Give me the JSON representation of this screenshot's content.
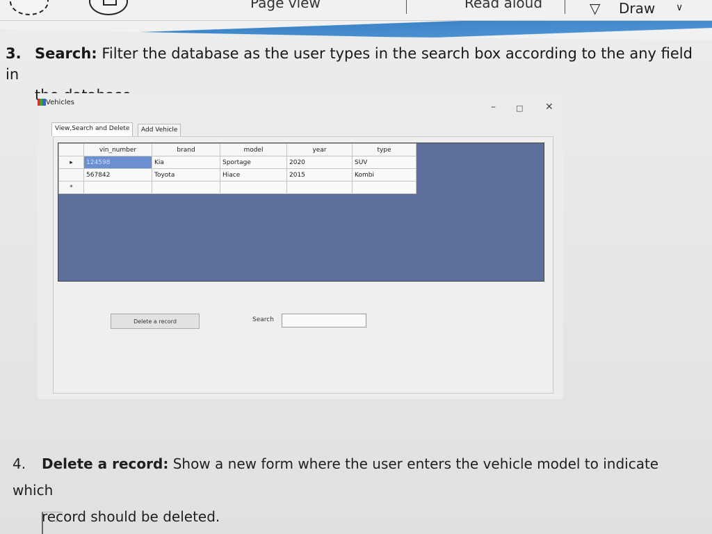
{
  "toolbar": {
    "page_view": "Page view",
    "read_aloud": "Read aloud",
    "draw": "Draw",
    "draw_icon": "pen-icon",
    "dropdown_icon": "chevron-down-icon"
  },
  "question3": {
    "number": "3.",
    "title": "Search:",
    "text_line1": " Filter the database as the user types in the search box according to the any field in",
    "text_line2": "the database."
  },
  "form": {
    "title": "Vehicles",
    "controls": {
      "minimize": "–",
      "maximize": "□",
      "close": "✕"
    },
    "tabs": [
      {
        "label": "View,Search and Delete",
        "active": true
      },
      {
        "label": "Add Vehicle",
        "active": false
      }
    ],
    "grid": {
      "columns": [
        "vin_number",
        "brand",
        "model",
        "year",
        "type"
      ],
      "rows": [
        {
          "indicator": "▸",
          "cells": [
            "124598",
            "Kia",
            "Sportage",
            "2020",
            "SUV"
          ]
        },
        {
          "indicator": "",
          "cells": [
            "567842",
            "Toyota",
            "Hiace",
            "2015",
            "Kombi"
          ]
        },
        {
          "indicator": "*",
          "cells": [
            "",
            "",
            "",
            "",
            ""
          ]
        }
      ]
    },
    "delete_button": "Delete a record",
    "search_label": "Search",
    "search_value": ""
  },
  "question4": {
    "number": "4.",
    "title": "Delete a record:",
    "text_line1": " Show a new form where the user enters the vehicle model to indicate which",
    "text_line2": "record should be deleted."
  },
  "colors": {
    "accent_blue": "#3d86c9",
    "grid_background": "#5c6f9a",
    "selected_cell": "#6b8fcf"
  }
}
